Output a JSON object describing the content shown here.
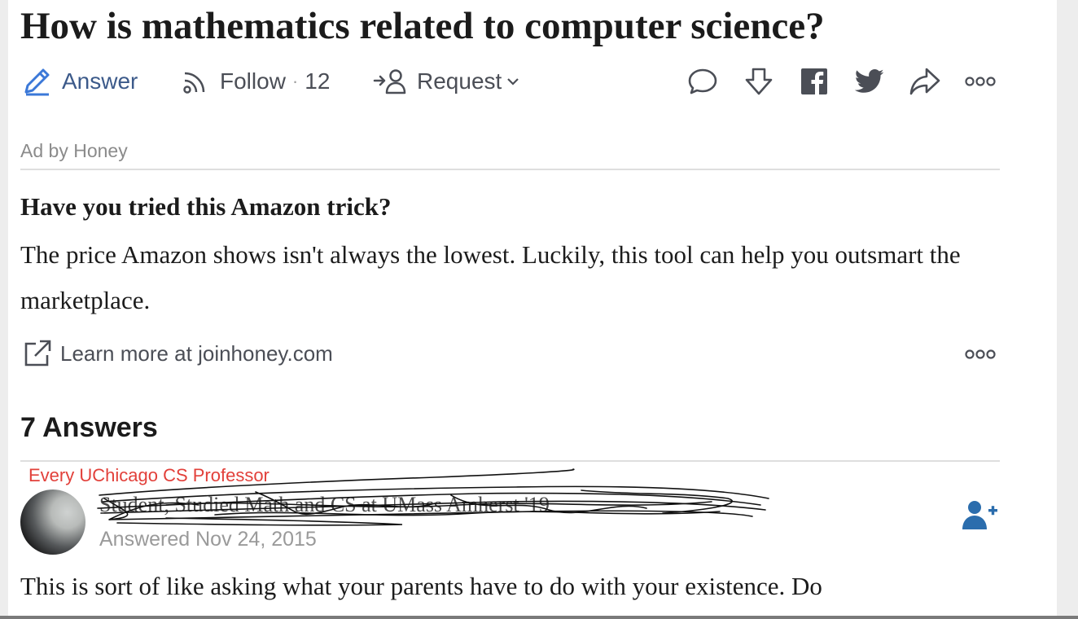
{
  "question": {
    "title": "How is mathematics related to computer science?"
  },
  "actions": {
    "answer_label": "Answer",
    "follow_label": "Follow",
    "follow_separator": "·",
    "follow_count": "12",
    "request_label": "Request"
  },
  "share_icons": [
    "comment-icon",
    "downvote-icon",
    "facebook-icon",
    "twitter-icon",
    "share-icon",
    "more-icon"
  ],
  "ad": {
    "sponsor": "Ad by Honey",
    "title": "Have you tried this Amazon trick?",
    "body": "The price Amazon shows isn't always the lowest. Luckily, this tool can help you outsmart the marketplace.",
    "link_label": "Learn more at joinhoney.com"
  },
  "answers": {
    "count_label": "7 Answers",
    "first": {
      "credential": "Every UChicago CS Professor",
      "author": "Student, Studied Math and CS at UMass Amherst '19",
      "answered": "Answered Nov 24, 2015",
      "text": "This is sort of like asking what your parents have to do with your existence. Do"
    }
  },
  "colors": {
    "accent_blue": "#3b78d8",
    "credential_red": "#e2403a",
    "follow_blue": "#2b6dad",
    "text_dark": "#1b1b1b",
    "icon_gray": "#4b4e56"
  }
}
